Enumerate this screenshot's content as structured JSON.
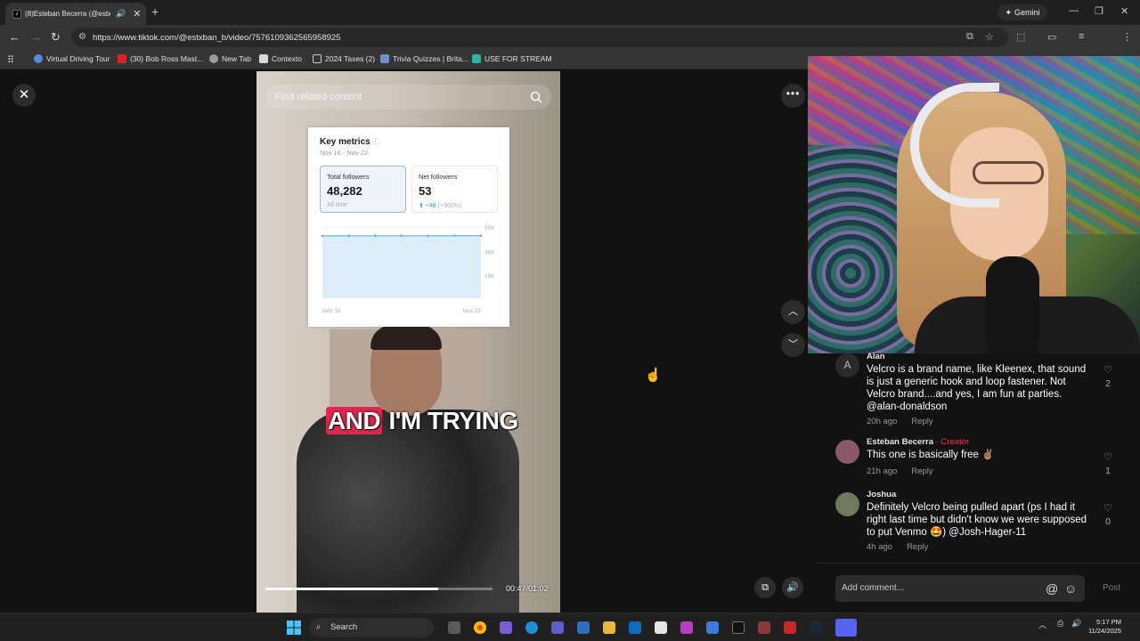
{
  "browser": {
    "tab_title": "(8)Esteban Becerra (@estx",
    "tab_favicon": "tiktok-icon",
    "gemini_label": "Gemini",
    "url": "https://www.tiktok.com/@estxban_b/video/7576109362565958925"
  },
  "bookmarks": [
    {
      "label": "Virtual Driving Tour",
      "icon": "globe-icon",
      "color": "#4f8fd6"
    },
    {
      "label": "(30) Bob Ross Mast...",
      "icon": "youtube-icon",
      "color": "#e02424"
    },
    {
      "label": "New Tab",
      "icon": "chrome-icon",
      "color": "#9a9a9a"
    },
    {
      "label": "Contexto",
      "icon": "contexto-icon",
      "color": "#d9d9d9"
    },
    {
      "label": "2024 Taxes (2)",
      "icon": "folder-icon",
      "color": "#c9c9c9"
    },
    {
      "label": "Trivia Quizzes | Brita...",
      "icon": "britannica-icon",
      "color": "#6d90c7"
    },
    {
      "label": "USE FOR STREAM",
      "icon": "pinterest-icon",
      "color": "#2db5a3"
    }
  ],
  "video": {
    "search_placeholder": "Find related content",
    "caption_highlight": "AND",
    "caption_rest": " I'M TRYING",
    "time": "00:47/01:02",
    "progress": 0.76
  },
  "metrics": {
    "title": "Key metrics",
    "info_icon": "info-icon",
    "range": "Nov 16 - Nov 22",
    "total_label": "Total followers",
    "total_value": "48,282",
    "total_sub": "All time",
    "net_label": "Net followers",
    "net_value": "53",
    "net_change": "+48",
    "net_change_pct": "(+960%)"
  },
  "chart_data": {
    "type": "area",
    "x_start_label": "Nov 16",
    "x_end_label": "Nov 22",
    "y_ticks": [
      "55K",
      "36K",
      "18K"
    ],
    "ylim": [
      0,
      55000
    ],
    "values": [
      48229,
      48238,
      48247,
      48256,
      48265,
      48274,
      48282
    ],
    "grid": true,
    "legend": "none"
  },
  "comments": [
    {
      "avatar_letter": "A",
      "name": "Alan",
      "creator": "",
      "text": "Velcro is a brand name, like Kleenex, that sound is just a generic hook and loop fastener. Not Velcro brand....and yes, I am fun at parties. @alan-donaldson",
      "time": "20h ago",
      "reply": "Reply",
      "likes": "2"
    },
    {
      "avatar_letter": "",
      "name": "Esteban Becerra",
      "creator": " · Creator",
      "text": "This one is basically free ✌🏽",
      "time": "21h ago",
      "reply": "Reply",
      "likes": "1"
    },
    {
      "avatar_letter": "",
      "name": "Joshua",
      "creator": "",
      "text": "Definitely Velcro being pulled apart (ps I had it right last time but didn't know we were supposed to put Venmo 🤩) @Josh-Hager-11",
      "time": "4h ago",
      "reply": "Reply",
      "likes": "0"
    }
  ],
  "comment_bar": {
    "placeholder": "Add comment...",
    "post_label": "Post"
  },
  "taskbar": {
    "search_label": "Search",
    "time": "5:17 PM",
    "date": "11/24/2025"
  }
}
